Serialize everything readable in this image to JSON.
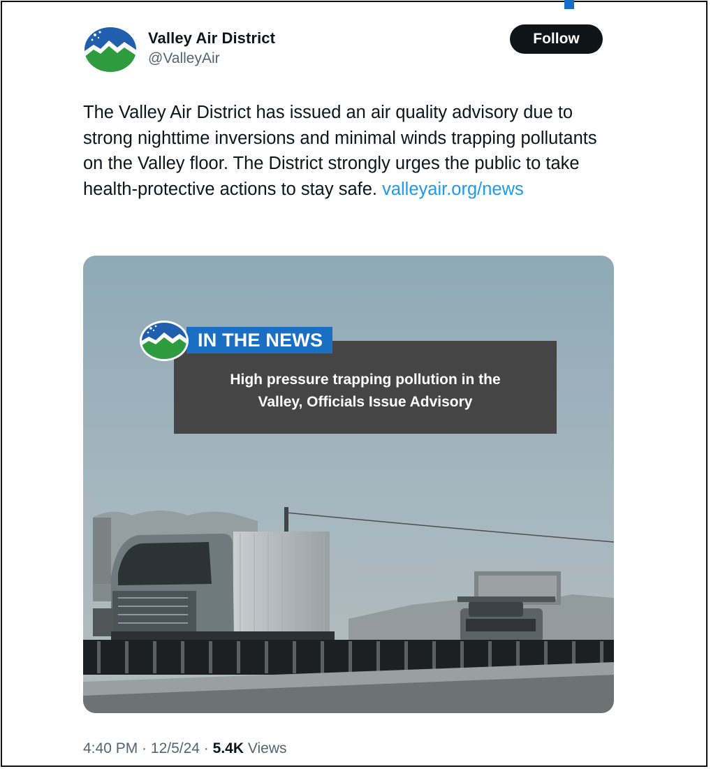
{
  "account": {
    "display_name": "Valley Air District",
    "handle": "@ValleyAir",
    "avatar_icon": "valley-air-logo-icon"
  },
  "follow_button": {
    "label": "Follow"
  },
  "tweet": {
    "text": "The Valley Air District has issued an air quality advisory due to strong nighttime inversions and minimal winds trapping pollutants on the Valley floor. The District strongly urges the public to take health-protective actions to stay safe. ",
    "link_text": "valleyair.org/news"
  },
  "media": {
    "badge_label": "IN THE NEWS",
    "headline_line1": "High pressure trapping pollution in the",
    "headline_line2": "Valley, Officials Issue Advisory"
  },
  "meta": {
    "time": "4:40 PM",
    "separator": " · ",
    "date": "12/5/24",
    "views_count": "5.4K",
    "views_label": "Views"
  },
  "colors": {
    "link": "#1d9bf0",
    "follow_bg": "#0f1419",
    "badge_blue": "#1a6fc2",
    "logo_green": "#2e9b3e",
    "logo_blue": "#1f5fae"
  }
}
